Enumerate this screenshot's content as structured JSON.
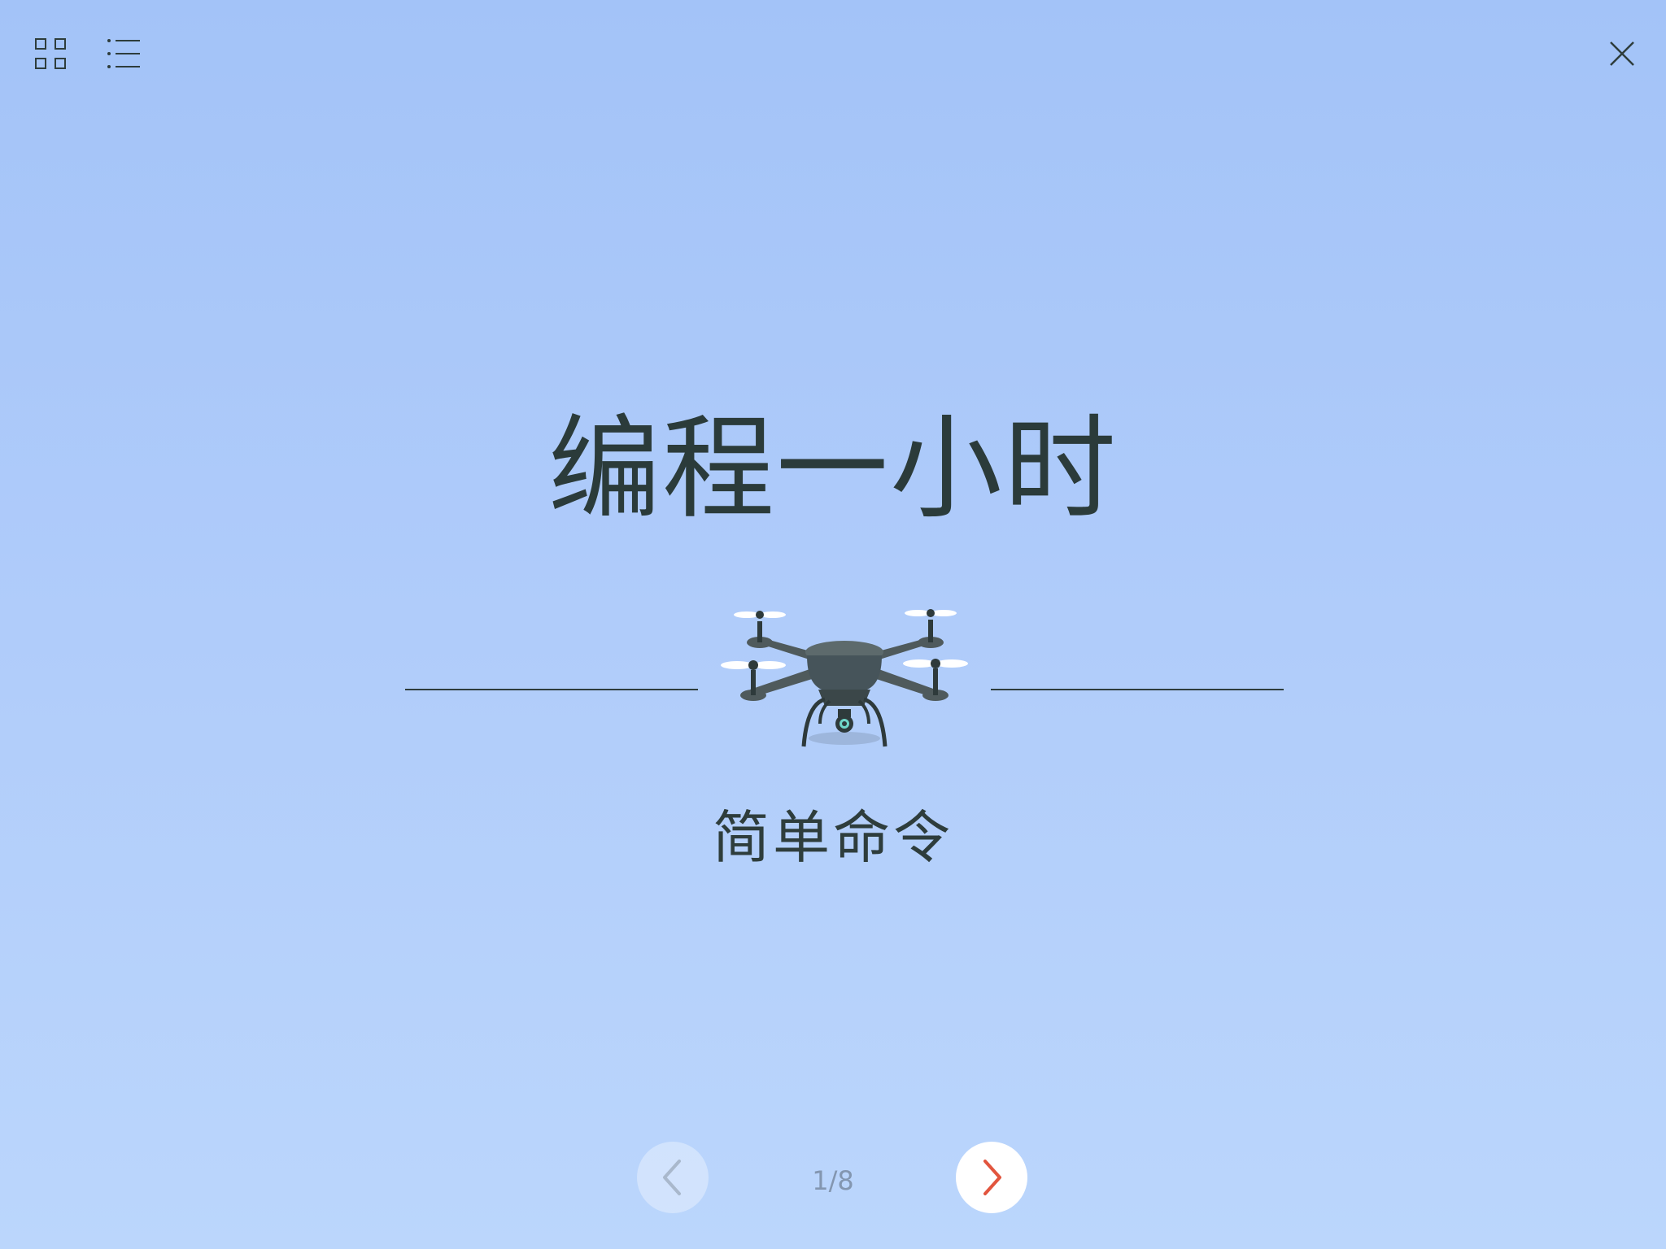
{
  "toolbar": {
    "grid_icon": "grid-icon",
    "list_icon": "list-icon",
    "close_icon": "close-icon"
  },
  "slide": {
    "title": "编程一小时",
    "subtitle": "简单命令",
    "illustration": "drone-illustration"
  },
  "pagination": {
    "current": 1,
    "total": 8,
    "label": "1/8",
    "prev_icon": "chevron-left-icon",
    "next_icon": "chevron-right-icon"
  },
  "colors": {
    "background_top": "#a3c3f8",
    "background_bottom": "#bbd6fc",
    "text": "#2e3d3c",
    "next_arrow": "#e2553e",
    "prev_arrow": "#a9b8cc"
  }
}
